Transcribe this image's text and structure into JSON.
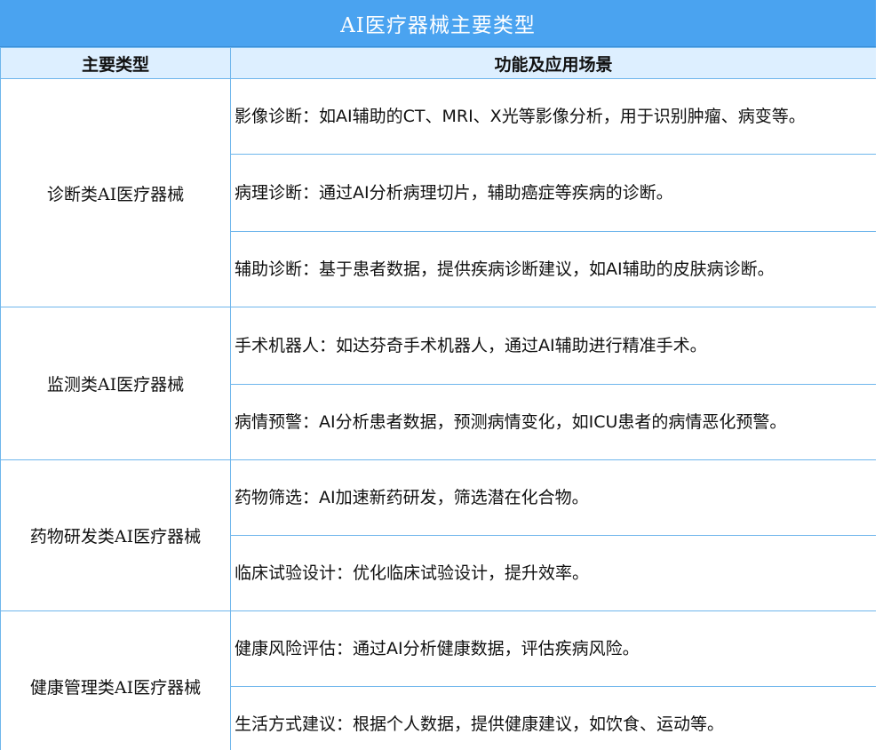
{
  "title": "AI医疗器械主要类型",
  "headers": {
    "type": "主要类型",
    "function": "功能及应用场景"
  },
  "groups": [
    {
      "category": "诊断类AI医疗器械",
      "items": [
        "影像诊断：如AI辅助的CT、MRI、X光等影像分析，用于识别肿瘤、病变等。",
        "病理诊断：通过AI分析病理切片，辅助癌症等疾病的诊断。",
        "辅助诊断：基于患者数据，提供疾病诊断建议，如AI辅助的皮肤病诊断。"
      ]
    },
    {
      "category": "监测类AI医疗器械",
      "items": [
        "手术机器人：如达芬奇手术机器人，通过AI辅助进行精准手术。",
        "病情预警：AI分析患者数据，预测病情变化，如ICU患者的病情恶化预警。"
      ]
    },
    {
      "category": "药物研发类AI医疗器械",
      "items": [
        "药物筛选：AI加速新药研发，筛选潜在化合物。",
        "临床试验设计：优化临床试验设计，提升效率。"
      ]
    },
    {
      "category": "健康管理类AI医疗器械",
      "items": [
        "健康风险评估：通过AI分析健康数据，评估疾病风险。",
        "生活方式建议：根据个人数据，提供健康建议，如饮食、运动等。"
      ]
    }
  ]
}
